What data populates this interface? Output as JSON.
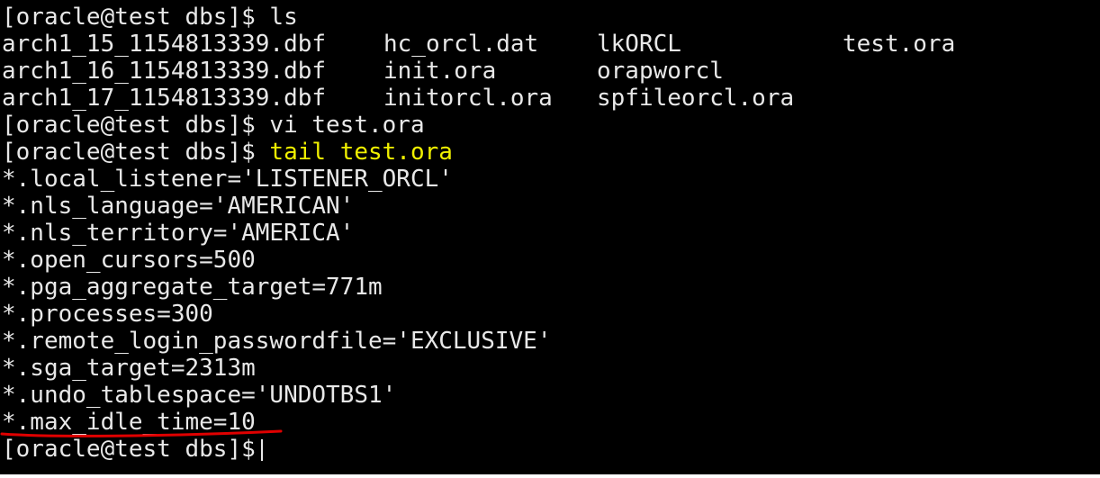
{
  "colors": {
    "background": "#000000",
    "text": "#e8e8e8",
    "highlight": "#f0f000",
    "annotation": "#e00000"
  },
  "terminal": {
    "prompt1": "[oracle@test dbs]$ ls",
    "ls_rows": [
      [
        "arch1_15_1154813339.dbf",
        "hc_orcl.dat",
        "lkORCL",
        "test.ora"
      ],
      [
        "arch1_16_1154813339.dbf",
        "init.ora",
        "orapworcl",
        ""
      ],
      [
        "arch1_17_1154813339.dbf",
        "initorcl.ora",
        "spfileorcl.ora",
        ""
      ]
    ],
    "prompt2": "[oracle@test dbs]$ vi test.ora",
    "prompt3_prefix": "[oracle@test dbs]$ ",
    "prompt3_cmd": "tail test.ora",
    "params": [
      "*.local_listener='LISTENER_ORCL'",
      "*.nls_language='AMERICAN'",
      "*.nls_territory='AMERICA'",
      "*.open_cursors=500",
      "*.pga_aggregate_target=771m",
      "*.processes=300",
      "*.remote_login_passwordfile='EXCLUSIVE'",
      "*.sga_target=2313m",
      "*.undo_tablespace='UNDOTBS1'",
      "*.max_idle_time=10"
    ],
    "final_prompt": "[oracle@test dbs]$"
  },
  "annotation": {
    "type": "underline",
    "target": "*.max_idle_time=10"
  }
}
